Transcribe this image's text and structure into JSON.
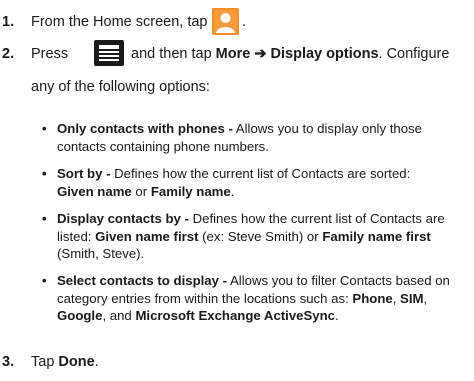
{
  "steps": [
    {
      "number": "1.",
      "text": "From the Home screen, tap",
      "icon": "contacts-app-icon",
      "after_icon": "."
    },
    {
      "number": "2.",
      "press": "Press",
      "icon": "menu-key-icon",
      "and_then_tap": "and then tap",
      "more": "More",
      "arrow": "➔",
      "display_options": "Display options",
      "configure": ". Configure",
      "line2": "any of the following options:"
    },
    {
      "number": "3.",
      "tap": "Tap",
      "done": "Done",
      "period": "."
    }
  ],
  "bullets": [
    {
      "term": "Only contacts with phones -",
      "line1_rest": " Allows you to display only those",
      "line2": "contacts containing phone numbers."
    },
    {
      "term": "Sort by -",
      "line1_rest": " Defines how the current list of Contacts are sorted:",
      "opt1": "Given name",
      "or": " or ",
      "opt2": "Family name",
      "end": "."
    },
    {
      "term": "Display contacts by -",
      "line1_rest": " Defines how the current list of Contacts are",
      "l2a": "listed: ",
      "opt1": "Given name first",
      "l2b": " (ex: Steve Smith) or ",
      "opt2": "Family name first",
      "l3": "(Smith, Steve)."
    },
    {
      "term": "Select contacts to display -",
      "line1_rest": " Allows you to filter Contacts based on",
      "line2": "category entries from within the locations such as: ",
      "phone": "Phone",
      "comma1": ", ",
      "sim": "SIM",
      "comma2": ",",
      "google": "Google",
      "and": ", and ",
      "exchange": "Microsoft Exchange ActiveSync",
      "end": "."
    }
  ],
  "bullet_char": "•",
  "colors": {
    "contacts_icon_bg": "#f28a2a",
    "menu_icon_bg": "#1a1a1a"
  }
}
